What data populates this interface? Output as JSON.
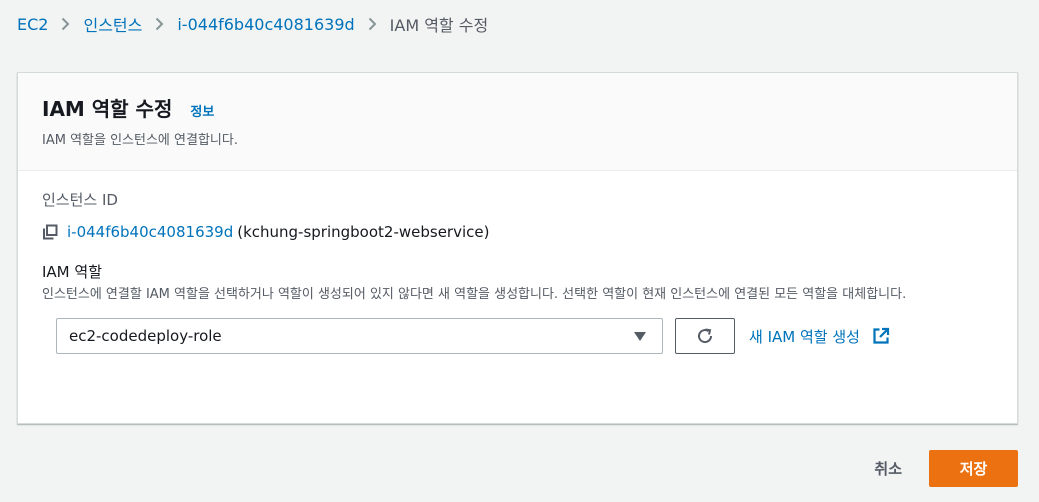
{
  "breadcrumb": {
    "items": [
      "EC2",
      "인스턴스",
      "i-044f6b40c4081639d"
    ],
    "current": "IAM 역할 수정"
  },
  "panel": {
    "title": "IAM 역할 수정",
    "info_link": "정보",
    "description": "IAM 역할을 인스턴스에 연결합니다."
  },
  "instance": {
    "label": "인스턴스 ID",
    "id": "i-044f6b40c4081639d",
    "name": "(kchung-springboot2-webservice)"
  },
  "iam_role": {
    "label": "IAM 역할",
    "description": "인스턴스에 연결할 IAM 역할을 선택하거나 역할이 생성되어 있지 않다면 새 역할을 생성합니다. 선택한 역할이 현재 인스턴스에 연결된 모든 역할을 대체합니다.",
    "selected": "ec2-codedeploy-role",
    "create_link": "새 IAM 역할 생성"
  },
  "footer": {
    "cancel_label": "취소",
    "save_label": "저장"
  },
  "colors": {
    "link": "#0073bb",
    "primary_button": "#ec7211",
    "page_background": "#f2f3f3"
  },
  "icons": [
    "chevron-right-icon",
    "copy-icon",
    "caret-down-icon",
    "refresh-icon",
    "external-link-icon"
  ]
}
